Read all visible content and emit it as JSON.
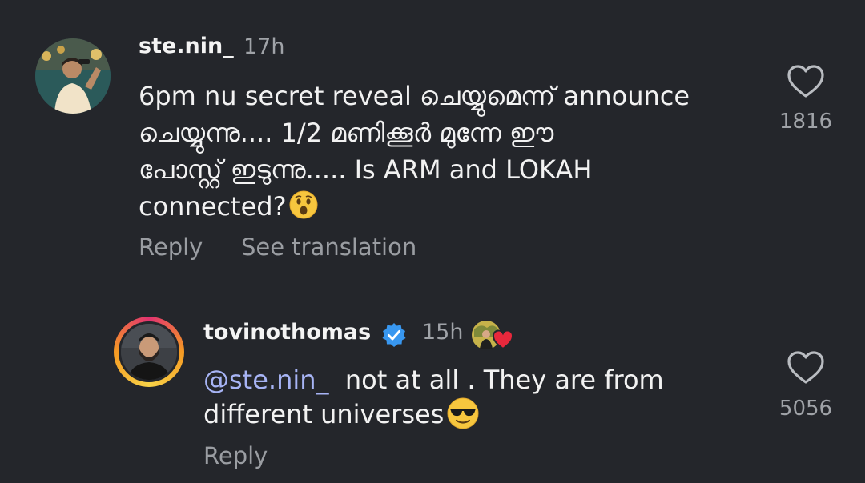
{
  "comment": {
    "username": "ste.nin_",
    "time": "17h",
    "text_line_1": "6pm nu secret reveal ചെയ്യുമെന്ന് announce",
    "text_line_2": "ചെയ്യുന്നു.... 1/2 മണിക്കൂർ മുന്നേ ഈ",
    "text_line_3": "പോസ്റ്റ് ഇടുന്നു..... Is ARM and LOKAH",
    "text_line_4": "connected?",
    "emoji": "hushed-face-emoji",
    "likes": "1816",
    "reply_label": "Reply",
    "translation_label": "See translation",
    "heart_icon": "heart-outline-icon"
  },
  "reply": {
    "username": "tovinothomas",
    "verified": true,
    "verified_color": "#3897f0",
    "time": "15h",
    "creator_liked_icon": "creator-liked-heart-icon",
    "mention": "@ste.nin_",
    "text_line_1": "not at all . They are from",
    "text_line_2": "different universes",
    "emoji": "smiling-face-with-sunglasses-emoji",
    "likes": "5056",
    "reply_label": "Reply",
    "heart_icon": "heart-outline-icon"
  },
  "colors": {
    "background": "#24262b",
    "mention": "#a7b4f5",
    "secondary_text": "#9a9da2",
    "creator_heart": "#e8283c"
  }
}
